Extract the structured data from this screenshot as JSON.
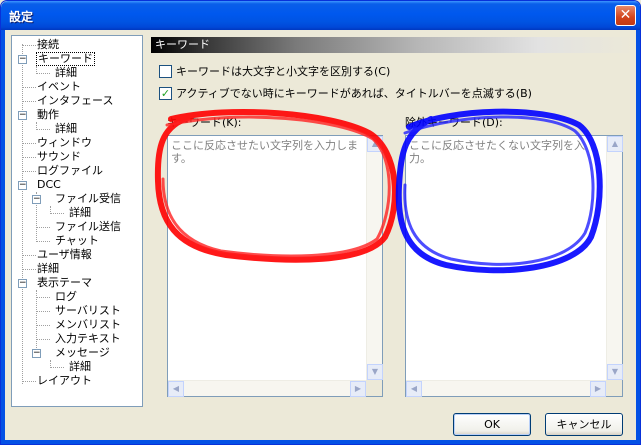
{
  "window": {
    "title": "設定",
    "close_glyph": "✕"
  },
  "tree": {
    "items": [
      {
        "label": "接続"
      },
      {
        "label": "キーワード"
      },
      {
        "label": "詳細"
      },
      {
        "label": "イベント"
      },
      {
        "label": "インタフェース"
      },
      {
        "label": "動作"
      },
      {
        "label": "詳細"
      },
      {
        "label": "ウィンドウ"
      },
      {
        "label": "サウンド"
      },
      {
        "label": "ログファイル"
      },
      {
        "label": "DCC"
      },
      {
        "label": "ファイル受信"
      },
      {
        "label": "詳細"
      },
      {
        "label": "ファイル送信"
      },
      {
        "label": "チャット"
      },
      {
        "label": "ユーザ情報"
      },
      {
        "label": "詳細"
      },
      {
        "label": "表示テーマ"
      },
      {
        "label": "ログ"
      },
      {
        "label": "サーバリスト"
      },
      {
        "label": "メンバリスト"
      },
      {
        "label": "入力テキスト"
      },
      {
        "label": "メッセージ"
      },
      {
        "label": "詳細"
      },
      {
        "label": "レイアウト"
      }
    ]
  },
  "section": {
    "header": "キーワード"
  },
  "options": {
    "case_sensitive": {
      "label": "キーワードは大文字と小文字を区別する(C)",
      "checked": false
    },
    "blink_titlebar": {
      "label": "アクティブでない時にキーワードがあれば、タイトルバーを点滅する(B)",
      "checked": true
    }
  },
  "keyword": {
    "label": "キーワード(K):",
    "placeholder": "ここに反応させたい文字列を入力します。"
  },
  "exclude": {
    "label": "除外キーワード(D):",
    "placeholder": "ここに反応させたくない文字列を入力。"
  },
  "buttons": {
    "ok": "OK",
    "cancel": "キャンセル"
  },
  "annotations": {
    "left_circle_color": "#ff0000",
    "right_circle_color": "#0000ff"
  },
  "icons": {
    "expander": "minus-expander-icon",
    "checkmark": "check-icon"
  },
  "glyphs": {
    "minus": "−",
    "check": "✓",
    "up": "▲",
    "down": "▼",
    "left": "◀",
    "right": "▶"
  }
}
